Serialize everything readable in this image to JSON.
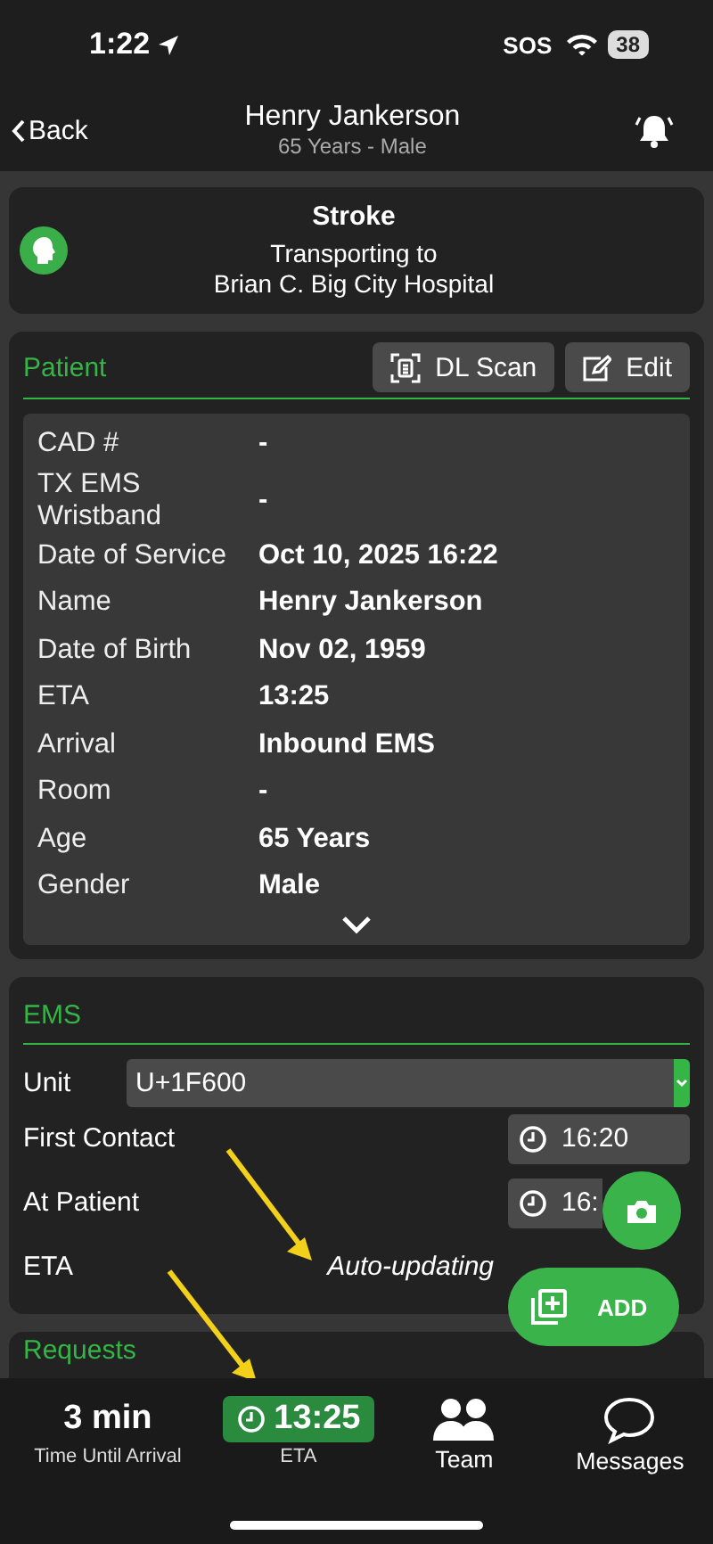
{
  "status_bar": {
    "time": "1:22",
    "sos": "SOS",
    "battery": "38"
  },
  "nav": {
    "back": "Back",
    "title": "Henry Jankerson",
    "subtitle": "65 Years - Male"
  },
  "alert": {
    "title": "Stroke",
    "lines": [
      "Transporting to",
      "Brian C. Big City Hospital"
    ]
  },
  "patient": {
    "title": "Patient",
    "expanded": false,
    "buttons": [
      {
        "kind": "scan",
        "label": "DL Scan"
      },
      {
        "kind": "edit",
        "label": "Edit"
      }
    ],
    "fields": [
      {
        "label": "CAD #",
        "value": "-"
      },
      {
        "label": "TX EMS Wristband",
        "value": "-"
      },
      {
        "label": "Date of Service",
        "value": "Oct 10, 2025 16:22"
      },
      {
        "label": "Name",
        "value": "Henry Jankerson"
      },
      {
        "label": "Date of Birth",
        "value": "Nov 02, 1959"
      },
      {
        "label": "ETA",
        "value": "13:25"
      },
      {
        "label": "Arrival",
        "value": "Inbound EMS"
      },
      {
        "label": "Room",
        "value": "-"
      },
      {
        "label": "Age",
        "value": "65 Years"
      },
      {
        "label": "Gender",
        "value": "Male"
      }
    ]
  },
  "ems": {
    "title": "EMS",
    "unit": {
      "label": "Unit",
      "value": "U+1F600"
    },
    "times": [
      {
        "label": "First Contact",
        "value": "16:20"
      },
      {
        "label": "At Patient",
        "value": "16:"
      },
      {
        "label": "ETA",
        "note": "Auto-updating"
      }
    ]
  },
  "requests": {
    "title": "Requests"
  },
  "add_button": {
    "label": "ADD"
  },
  "bottom_bar": {
    "items": [
      {
        "kind": "stat",
        "value": "3 min",
        "label": "Time Until Arrival"
      },
      {
        "kind": "eta",
        "value": "13:25",
        "label": "ETA"
      },
      {
        "kind": "team",
        "label": "Team"
      },
      {
        "kind": "messages",
        "label": "Messages"
      }
    ]
  }
}
